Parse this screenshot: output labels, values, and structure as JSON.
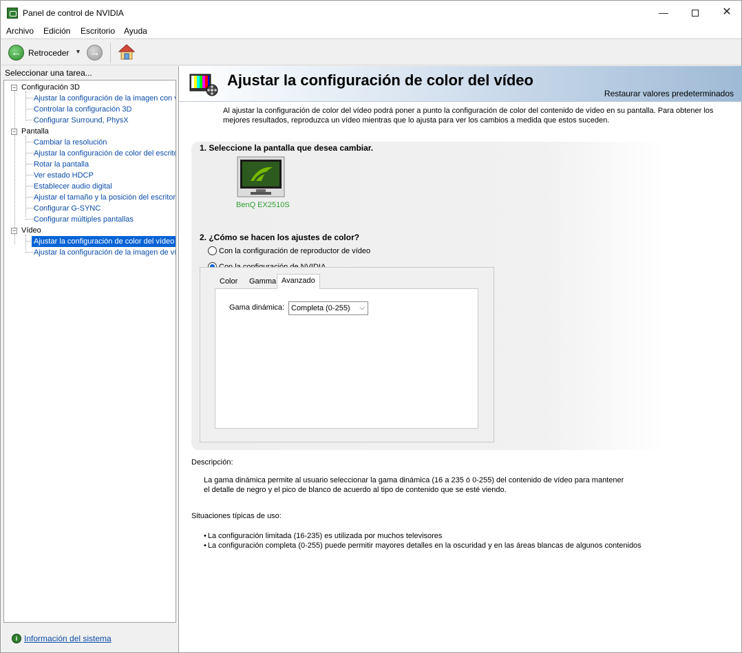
{
  "window": {
    "title": "Panel de control de NVIDIA",
    "minimize_glyph": "—",
    "close_glyph": "✕"
  },
  "menu": [
    "Archivo",
    "Edición",
    "Escritorio",
    "Ayuda"
  ],
  "toolbar": {
    "back_label": "Retroceder",
    "back_dropdown_glyph": "▼",
    "back_glyph": "←",
    "forward_glyph": "→"
  },
  "left_panel": {
    "task_label": "Seleccionar una tarea...",
    "tree": {
      "cat3d": "Configuración 3D",
      "cat3d_items": [
        "Ajustar la configuración de la imagen con v",
        "Controlar la configuración 3D",
        "Configurar Surround, PhysX"
      ],
      "catPantalla": "Pantalla",
      "catPantalla_items": [
        "Cambiar la resolución",
        "Ajustar la configuración de color del escrito",
        "Rotar la pantalla",
        "Ver estado HDCP",
        "Establecer audio digital",
        "Ajustar el tamaño y la posición del escritori",
        "Configurar G-SYNC",
        "Configurar múltiples pantallas"
      ],
      "catVideo": "Vídeo",
      "catVideo_items": [
        "Ajustar la configuración de color del vídeo",
        "Ajustar la configuración de la imagen de víd"
      ],
      "expander_glyph": "−"
    },
    "sysinfo_link": "Información del sistema",
    "sysinfo_glyph": "i"
  },
  "content": {
    "title": "Ajustar la configuración de color del vídeo",
    "restore": "Restaurar valores predeterminados",
    "intro": "Al ajustar la configuración de color del vídeo podrá poner a punto la configuración de color del contenido de vídeo en su pantalla. Para obtener los mejores resultados, reproduzca un vídeo mientras que lo ajusta para ver los cambios a medida que estos suceden.",
    "section1_title": "1. Seleccione la pantalla que desea cambiar.",
    "monitor_name": "BenQ EX2510S",
    "section2_title": "2. ¿Cómo se hacen los ajustes de color?",
    "radio1": "Con la configuración de reproductor de vídeo",
    "radio2": "Con la configuración de NVIDIA",
    "selected_radio": 2,
    "tabs": [
      "Color",
      "Gamma",
      "Avanzado"
    ],
    "active_tab": "Avanzado",
    "field_label": "Gama dinámica:",
    "field_value": "Completa (0-255)",
    "select_chevron": "⌵",
    "desc_heading": "Descripción:",
    "desc_text": "La gama dinámica permite al usuario seleccionar la gama dinámica (16 a 235 ó 0-255) del contenido de vídeo para mantener el detalle de negro y el pico de blanco de acuerdo al tipo de contenido que se esté viendo.",
    "usage_heading": "Situaciones típicas de uso:",
    "usage_items": [
      "La configuración limitada (16-235) es utilizada por muchos televisores",
      "La configuración completa (0-255) puede permitir mayores detalles en la oscuridad y en las áreas blancas de algunos contenidos"
    ]
  },
  "colors": {
    "link": "#0a4ca8",
    "selection": "#0a64d6",
    "nvidia_green": "#2e9c2e"
  }
}
